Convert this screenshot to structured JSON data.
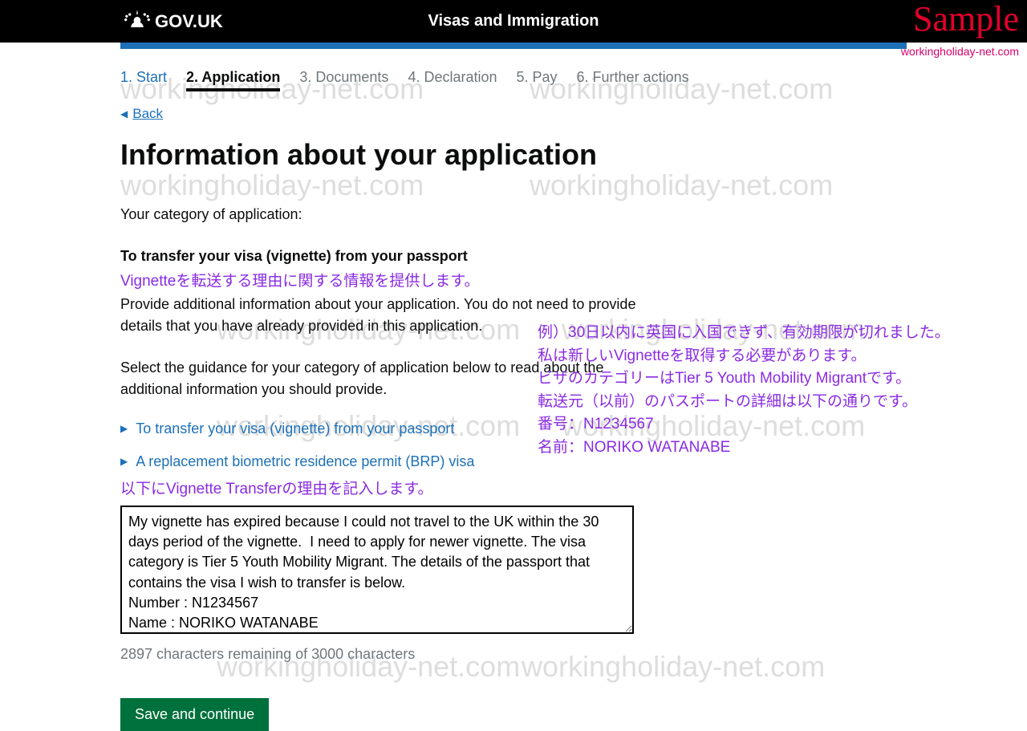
{
  "header": {
    "govuk": "GOV.UK",
    "service": "Visas and Immigration"
  },
  "overlay": {
    "sample": "Sample",
    "source_url": "workingholiday-net.com",
    "watermark": "workingholiday-net.com"
  },
  "steps": {
    "s1": "1. Start",
    "s2": "2. Application",
    "s3": "3. Documents",
    "s4": "4. Declaration",
    "s5": "5. Pay",
    "s6": "6. Further actions"
  },
  "back": "Back",
  "title": "Information about your application",
  "category": {
    "label": "Your category of application:",
    "value": "To transfer your visa (vignette) from your passport"
  },
  "annot": {
    "reason_heading": "Vignetteを転送する理由に関する情報を提供します。",
    "reason_note": "以下にVignette Transferの理由を記入します。",
    "example_l1": "例）30日以内に英国に入国できず、有効期限が切れました。",
    "example_l2": "私は新しいVignetteを取得する必要があります。",
    "example_l3": "ビザのカテゴリーはTier 5 Youth Mobility Migrantです。",
    "example_l4": "転送元（以前）のパスポートの詳細は以下の通りです。",
    "example_l5": "番号：N1234567",
    "example_l6": "名前：NORIKO WATANABE"
  },
  "instruction1": "Provide additional information about your application. You do not need to provide details that you have already provided in this application.",
  "instruction2": "Select the guidance for your category of application below to read about the additional information you should provide.",
  "disclosure1": "To transfer your visa (vignette) from your passport",
  "disclosure2": "A replacement biometric residence permit (BRP) visa",
  "textarea_value": "My vignette has expired because I could not travel to the UK within the 30 days period of the vignette.  I need to apply for newer vignette. The visa category is Tier 5 Youth Mobility Migrant. The details of the passport that contains the visa I wish to transfer is below.\nNumber : N1234567\nName : NORIKO WATANABE",
  "char_count": "2897 characters remaining of 3000 characters",
  "save_btn": "Save and continue"
}
